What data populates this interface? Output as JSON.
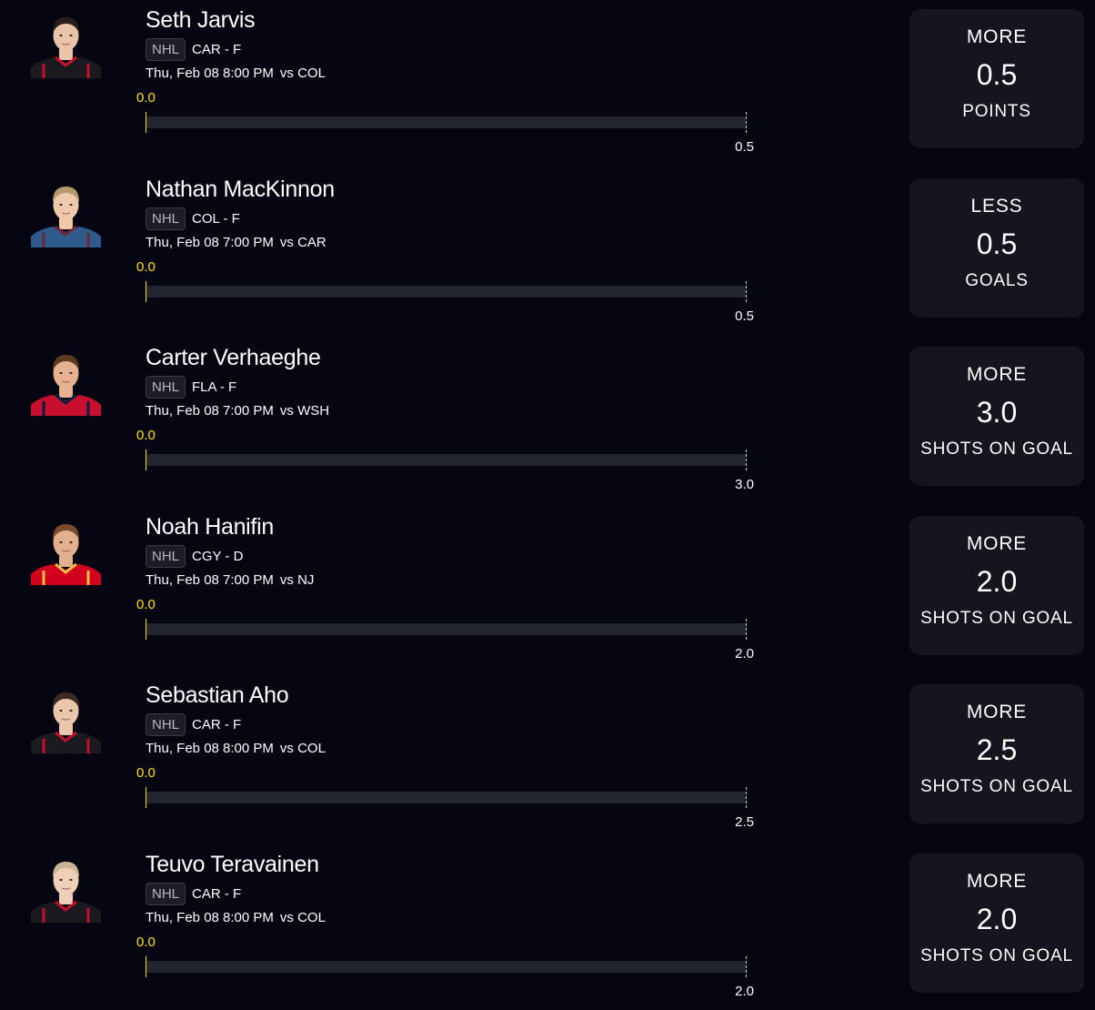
{
  "players": [
    {
      "name": "Seth Jarvis",
      "league": "NHL",
      "team_position": "CAR - F",
      "game_time": "Thu, Feb 08 8:00 PM",
      "opponent": "vs COL",
      "current_value": "0.0",
      "line": "0.5",
      "pick": "MORE",
      "stat": "POINTS",
      "progress": 0,
      "jersey_color": "#1a1a1f",
      "jersey_trim": "#c8102e",
      "hair_color": "#2a1e18",
      "skin_color": "#e9c4a8"
    },
    {
      "name": "Nathan MacKinnon",
      "league": "NHL",
      "team_position": "COL - F",
      "game_time": "Thu, Feb 08 7:00 PM",
      "opponent": "vs CAR",
      "current_value": "0.0",
      "line": "0.5",
      "pick": "LESS",
      "stat": "GOALS",
      "progress": 0,
      "jersey_color": "#2f5a8c",
      "jersey_trim": "#6f2633",
      "hair_color": "#b49a6c",
      "skin_color": "#f0c9ad"
    },
    {
      "name": "Carter Verhaeghe",
      "league": "NHL",
      "team_position": "FLA - F",
      "game_time": "Thu, Feb 08 7:00 PM",
      "opponent": "vs WSH",
      "current_value": "0.0",
      "line": "3.0",
      "pick": "MORE",
      "stat": "SHOTS ON GOAL",
      "progress": 0,
      "jersey_color": "#c8102e",
      "jersey_trim": "#041e42",
      "hair_color": "#5a3b22",
      "skin_color": "#e6b292"
    },
    {
      "name": "Noah Hanifin",
      "league": "NHL",
      "team_position": "CGY - D",
      "game_time": "Thu, Feb 08 7:00 PM",
      "opponent": "vs NJ",
      "current_value": "0.0",
      "line": "2.0",
      "pick": "MORE",
      "stat": "SHOTS ON GOAL",
      "progress": 0,
      "jersey_color": "#d2001c",
      "jersey_trim": "#f1be48",
      "hair_color": "#7a4a28",
      "skin_color": "#e2b08e"
    },
    {
      "name": "Sebastian Aho",
      "league": "NHL",
      "team_position": "CAR - F",
      "game_time": "Thu, Feb 08 8:00 PM",
      "opponent": "vs COL",
      "current_value": "0.0",
      "line": "2.5",
      "pick": "MORE",
      "stat": "SHOTS ON GOAL",
      "progress": 0,
      "jersey_color": "#1a1a1f",
      "jersey_trim": "#c8102e",
      "hair_color": "#3a2a20",
      "skin_color": "#ebc6ab"
    },
    {
      "name": "Teuvo Teravainen",
      "league": "NHL",
      "team_position": "CAR - F",
      "game_time": "Thu, Feb 08 8:00 PM",
      "opponent": "vs COL",
      "current_value": "0.0",
      "line": "2.0",
      "pick": "MORE",
      "stat": "SHOTS ON GOAL",
      "progress": 0,
      "jersey_color": "#1a1a1f",
      "jersey_trim": "#c8102e",
      "hair_color": "#c9b593",
      "skin_color": "#efcfb8"
    }
  ]
}
